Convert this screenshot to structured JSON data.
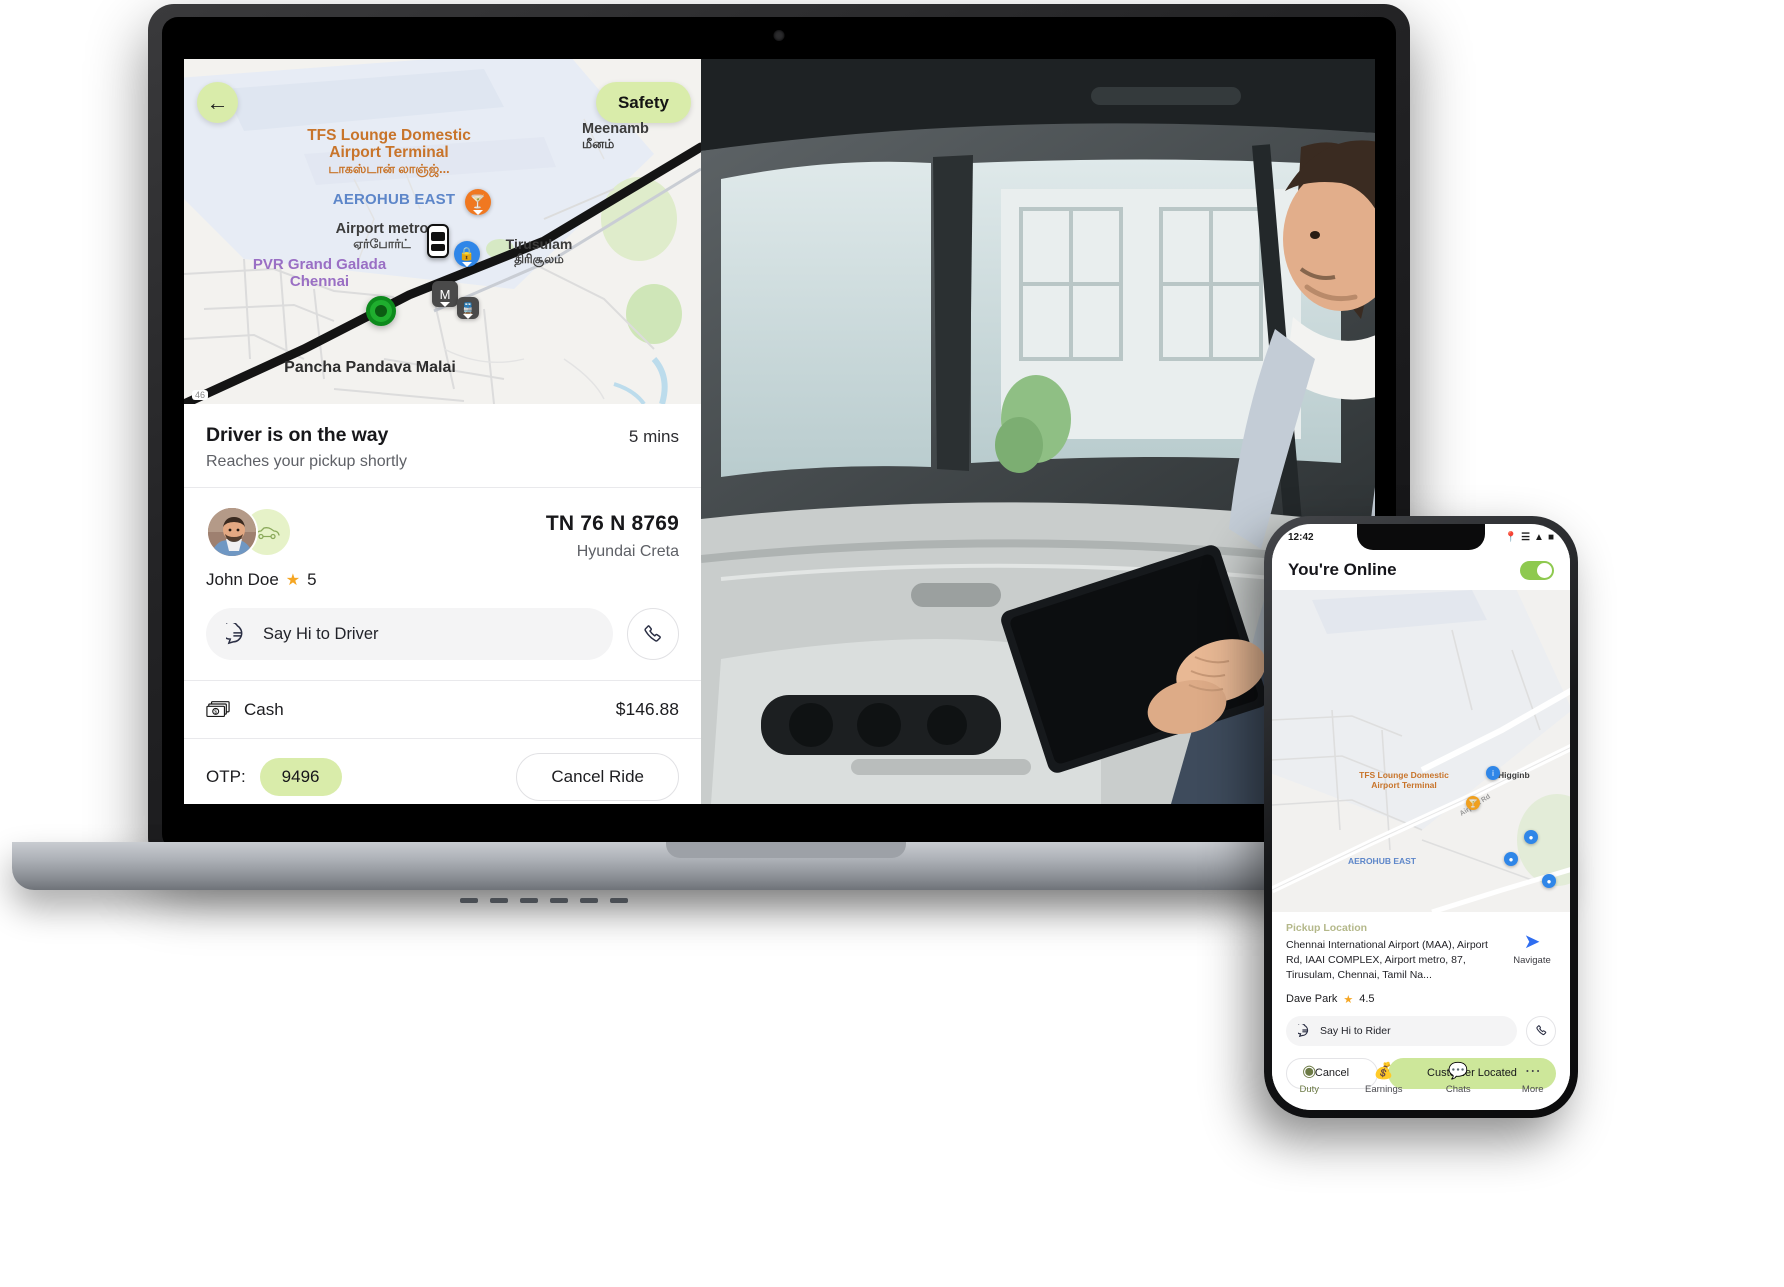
{
  "laptop": {
    "map": {
      "back_icon": "arrow-left-icon",
      "safety_label": "Safety",
      "labels": [
        {
          "name": "TFS Lounge Domestic Airport Terminal",
          "tamil": "டாகஸ்டான் லாஞ்ஜ்...",
          "color": "#c8742a"
        },
        {
          "name": "AEROHUB EAST",
          "color": "#5d86c9"
        },
        {
          "name": "Airport metro",
          "tamil": "ஏர்போர்ட்",
          "color": "#3c3c3c"
        },
        {
          "name": "Tirusulam",
          "tamil": "திரிசூலம்",
          "color": "#3c3c3c"
        },
        {
          "name": "PVR Grand Galada Chennai",
          "color": "#9a6fc4"
        },
        {
          "name": "Pancha Pandava Malai",
          "color": "#2e2e2e"
        },
        {
          "name": "Meenamb",
          "tamil": "மீனம்",
          "color": "#3c3c3c"
        }
      ],
      "scale_badge": "46",
      "car_marker_icon": "car-marker-icon",
      "pickup_marker_icon": "pickup-pin-icon"
    },
    "sheet": {
      "title": "Driver is on the way",
      "subtitle": "Reaches your pickup shortly",
      "eta": "5 mins",
      "driver": {
        "name": "John Doe",
        "rating": "5",
        "avatar_icon": "driver-avatar",
        "vehicle_icon": "car-side-icon"
      },
      "vehicle": {
        "plate": "TN 76 N 8769",
        "model": "Hyundai Creta"
      },
      "say_hi_label": "Say Hi to Driver",
      "say_hi_icon": "chat-bubble-icon",
      "call_icon": "phone-icon",
      "payment": {
        "icon": "cash-icon",
        "method": "Cash",
        "amount": "$146.88"
      },
      "otp_label": "OTP:",
      "otp_value": "9496",
      "cancel_label": "Cancel Ride"
    }
  },
  "phone": {
    "status_time": "12:42",
    "status_icons": [
      "location-icon",
      "signal-icon",
      "wifi-icon",
      "battery-icon"
    ],
    "online_title": "You're Online",
    "toggle_state": "on",
    "map": {
      "labels": [
        {
          "name": "TFS Lounge Domestic Airport Terminal",
          "color": "#c8742a"
        },
        {
          "name": "AEROHUB EAST",
          "color": "#5d86c9"
        },
        {
          "name": "Higginb",
          "color": "#3c3c3c"
        },
        {
          "name": "Airport Rd",
          "color": "#9a9a9a"
        }
      ]
    },
    "card": {
      "pickup_title": "Pickup Location",
      "pickup_address": "Chennai International Airport (MAA), Airport Rd, IAAI COMPLEX, Airport metro, 87, Tirusulam, Chennai, Tamil Na...",
      "navigate_label": "Navigate",
      "navigate_icon": "navigation-arrow-icon",
      "rider_name": "Dave Park",
      "rider_rating": "4.5",
      "say_hi_label": "Say Hi to Rider",
      "say_hi_icon": "chat-bubble-icon",
      "call_icon": "phone-icon",
      "cancel_label": "Cancel",
      "located_label": "Customer Located"
    },
    "tabs": [
      {
        "label": "Duty",
        "icon": "steering-wheel-icon",
        "active": true
      },
      {
        "label": "Earnings",
        "icon": "earnings-icon",
        "active": false
      },
      {
        "label": "Chats",
        "icon": "chat-icon",
        "active": false
      },
      {
        "label": "More",
        "icon": "more-dots-icon",
        "active": false
      }
    ]
  },
  "colors": {
    "accent_green": "#d9ecaa",
    "button_green": "#cde79a",
    "orange": "#c8742a",
    "blue": "#5d86c9",
    "purple": "#9a6fc4",
    "star": "#f5a623"
  }
}
